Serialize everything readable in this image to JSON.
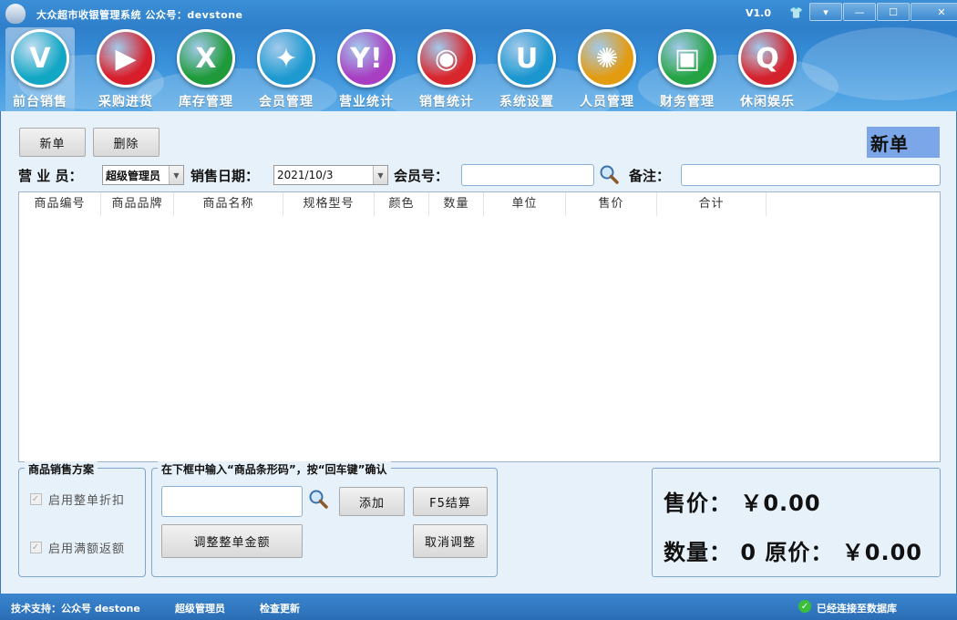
{
  "app": {
    "title": "大众超市收银管理系统  公众号：devstone",
    "version": "V1.0",
    "window_buttons": {
      "menu": "▾",
      "minimize": "—",
      "maximize": "☐",
      "close": "✕"
    }
  },
  "nav": {
    "items": [
      {
        "label": "前台销售",
        "icon": "V",
        "color": "#12a7c4",
        "active": true
      },
      {
        "label": "采购进货",
        "icon": "▶",
        "color": "#d71e2a",
        "active": false
      },
      {
        "label": "库存管理",
        "icon": "X",
        "color": "#1f9a3a",
        "active": false
      },
      {
        "label": "会员管理",
        "icon": "✦",
        "color": "#1e9ad0",
        "active": false
      },
      {
        "label": "营业统计",
        "icon": "Y!",
        "color": "#a83fc2",
        "active": false
      },
      {
        "label": "销售统计",
        "icon": "◉",
        "color": "#d8262d",
        "active": false
      },
      {
        "label": "系统设置",
        "icon": "U",
        "color": "#1c96cf",
        "active": false
      },
      {
        "label": "人员管理",
        "icon": "✺",
        "color": "#e39b10",
        "active": false
      },
      {
        "label": "财务管理",
        "icon": "▣",
        "color": "#25a344",
        "active": false
      },
      {
        "label": "休闲娱乐",
        "icon": "Q",
        "color": "#d4222c",
        "active": false
      }
    ]
  },
  "toolbar": {
    "new_label": "新单",
    "delete_label": "删除",
    "mode_badge": "新单"
  },
  "form": {
    "salesperson_label": "营 业 员：",
    "salesperson_value": "超级管理员",
    "date_label": "销售日期：",
    "date_value": "2021/10/3",
    "member_label": "会员号：",
    "member_value": "",
    "note_label": "备注：",
    "note_value": ""
  },
  "grid": {
    "columns": [
      "商品编号",
      "商品品牌",
      "商品名称",
      "规格型号",
      "颜色",
      "数量",
      "单位",
      "售价",
      "合计"
    ],
    "rows": []
  },
  "plan": {
    "title": "商品销售方案",
    "options": [
      {
        "label": "启用整单折扣",
        "checked": true
      },
      {
        "label": "启用满额返额",
        "checked": true
      }
    ]
  },
  "barcode": {
    "title": "在下框中输入“商品条形码”，按“回车键”确认",
    "input_value": "",
    "add_label": "添加",
    "checkout_label": "F5结算",
    "adjust_label": "调整整单金额",
    "cancel_adjust_label": "取消调整"
  },
  "summary": {
    "price_line": "售价：  ￥0.00",
    "qty_line": "数量：  0 原价：  ￥0.00"
  },
  "status": {
    "support": "技术支持：公众号 destone",
    "user": "超级管理员",
    "update": "检查更新",
    "db": "已经连接至数据库"
  }
}
